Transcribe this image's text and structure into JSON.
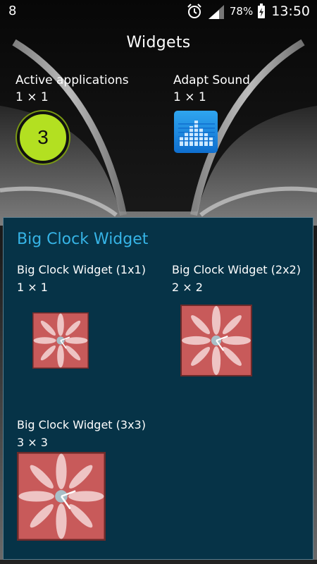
{
  "status_bar": {
    "left_icon": "8",
    "battery_percent": "78%",
    "time": "13:50"
  },
  "header": {
    "title": "Widgets"
  },
  "widgets_top": [
    {
      "name": "Active applications",
      "size": "1 × 1",
      "icon_text": "3"
    },
    {
      "name": "Adapt Sound",
      "size": "1 × 1"
    }
  ],
  "panel": {
    "title": "Big Clock Widget",
    "items": [
      {
        "name": "Big Clock Widget (1x1)",
        "size": "1 × 1"
      },
      {
        "name": "Big Clock Widget (2x2)",
        "size": "2 × 2"
      },
      {
        "name": "Big Clock Widget (3x3)",
        "size": "3 × 3"
      }
    ]
  }
}
